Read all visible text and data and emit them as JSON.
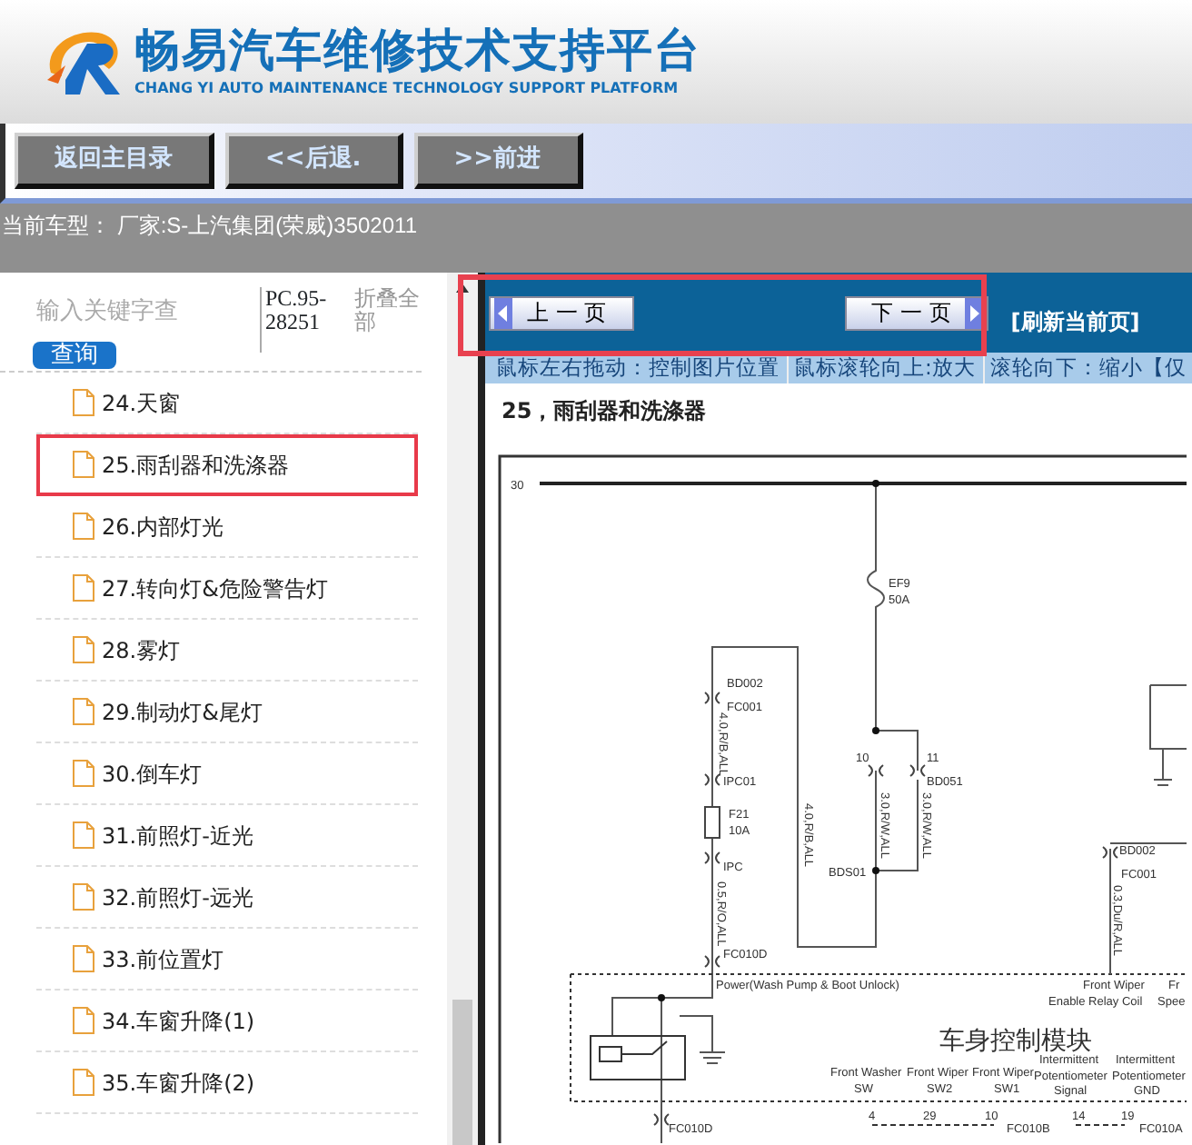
{
  "header": {
    "title": "畅易汽车维修技术支持平台",
    "subtitle": "CHANG YI AUTO MAINTENANCE TECHNOLOGY SUPPORT PLATFORM"
  },
  "toolbar": {
    "buttons": [
      "返回主目录",
      "<<后退.",
      ">>前进"
    ]
  },
  "current_model": "当前车型：  厂家:S-上汽集团(荣威)3502011",
  "sidebar": {
    "search": {
      "placeholder": "输入关键字查"
    },
    "search_button": "查询",
    "code": "PC.95-28251",
    "collapse_link": "折叠全部",
    "items": [
      {
        "label": "24.天窗",
        "selected": false
      },
      {
        "label": "25.雨刮器和洗涤器",
        "selected": true
      },
      {
        "label": "26.内部灯光",
        "selected": false
      },
      {
        "label": "27.转向灯&危险警告灯",
        "selected": false
      },
      {
        "label": "28.雾灯",
        "selected": false
      },
      {
        "label": "29.制动灯&尾灯",
        "selected": false
      },
      {
        "label": "30.倒车灯",
        "selected": false
      },
      {
        "label": "31.前照灯-近光",
        "selected": false
      },
      {
        "label": "32.前照灯-远光",
        "selected": false
      },
      {
        "label": "33.前位置灯",
        "selected": false
      },
      {
        "label": "34.车窗升降(1)",
        "selected": false
      },
      {
        "label": "35.车窗升降(2)",
        "selected": false
      }
    ]
  },
  "viewer": {
    "prev_button": "上 一 页",
    "next_button": "下 一 页",
    "highlighted": true,
    "refresh_link": "[刷新当前页]",
    "hint": [
      "鼠标左右拖动：控制图片位置",
      "鼠标滚轮向上:放大",
      "滚轮向下：缩小【仅"
    ],
    "page_title": "25，雨刮器和洗涤器",
    "diagram_labels": [
      {
        "text": "30",
        "kind": "label"
      },
      {
        "text": "EF9",
        "kind": "label"
      },
      {
        "text": "50A",
        "kind": "label"
      },
      {
        "text": "BD002",
        "kind": "label"
      },
      {
        "text": "FC001",
        "kind": "label"
      },
      {
        "text": "4.0,R/B,ALL",
        "kind": "vertical"
      },
      {
        "text": "IPC01",
        "kind": "label"
      },
      {
        "text": "10",
        "kind": "label"
      },
      {
        "text": "11",
        "kind": "label"
      },
      {
        "text": "BD051",
        "kind": "label"
      },
      {
        "text": "3.0,R/W,ALL",
        "kind": "vertical"
      },
      {
        "text": "3.0,R/W,ALL",
        "kind": "vertical"
      },
      {
        "text": "4.0,R/B,ALL",
        "kind": "vertical"
      },
      {
        "text": "F21",
        "kind": "label"
      },
      {
        "text": "10A",
        "kind": "label"
      },
      {
        "text": "IPC",
        "kind": "label"
      },
      {
        "text": "0.5,R/O,ALL",
        "kind": "vertical"
      },
      {
        "text": "BDS01",
        "kind": "label"
      },
      {
        "text": "BD002",
        "kind": "label"
      },
      {
        "text": "FC001",
        "kind": "label"
      },
      {
        "text": "0.3,Du/R,ALL",
        "kind": "vertical"
      },
      {
        "text": "FC010D",
        "kind": "label"
      },
      {
        "text": "Power(Wash Pump & Boot Unlock)",
        "kind": "label"
      },
      {
        "text": "Front Wiper",
        "kind": "label"
      },
      {
        "text": "Enable Relay Coil",
        "kind": "label"
      },
      {
        "text": "Fr",
        "kind": "label"
      },
      {
        "text": "Spee",
        "kind": "label"
      },
      {
        "text": "车身控制模块",
        "kind": "title"
      },
      {
        "text": "Front Washer",
        "kind": "label"
      },
      {
        "text": "SW",
        "kind": "label"
      },
      {
        "text": "Front Wiper",
        "kind": "label"
      },
      {
        "text": "SW2",
        "kind": "label"
      },
      {
        "text": "Front Wiper",
        "kind": "label"
      },
      {
        "text": "SW1",
        "kind": "label"
      },
      {
        "text": "Intermittent",
        "kind": "label"
      },
      {
        "text": "Potentiometer",
        "kind": "label"
      },
      {
        "text": "Signal",
        "kind": "label"
      },
      {
        "text": "Intermittent",
        "kind": "label"
      },
      {
        "text": "Potentiometer",
        "kind": "label"
      },
      {
        "text": "GND",
        "kind": "label"
      },
      {
        "text": "FC010D",
        "kind": "label"
      },
      {
        "text": "4",
        "kind": "label"
      },
      {
        "text": "29",
        "kind": "label"
      },
      {
        "text": "10",
        "kind": "label"
      },
      {
        "text": "FC010B",
        "kind": "label"
      },
      {
        "text": "14",
        "kind": "label"
      },
      {
        "text": "19",
        "kind": "label"
      },
      {
        "text": "FC010A",
        "kind": "label"
      }
    ]
  }
}
